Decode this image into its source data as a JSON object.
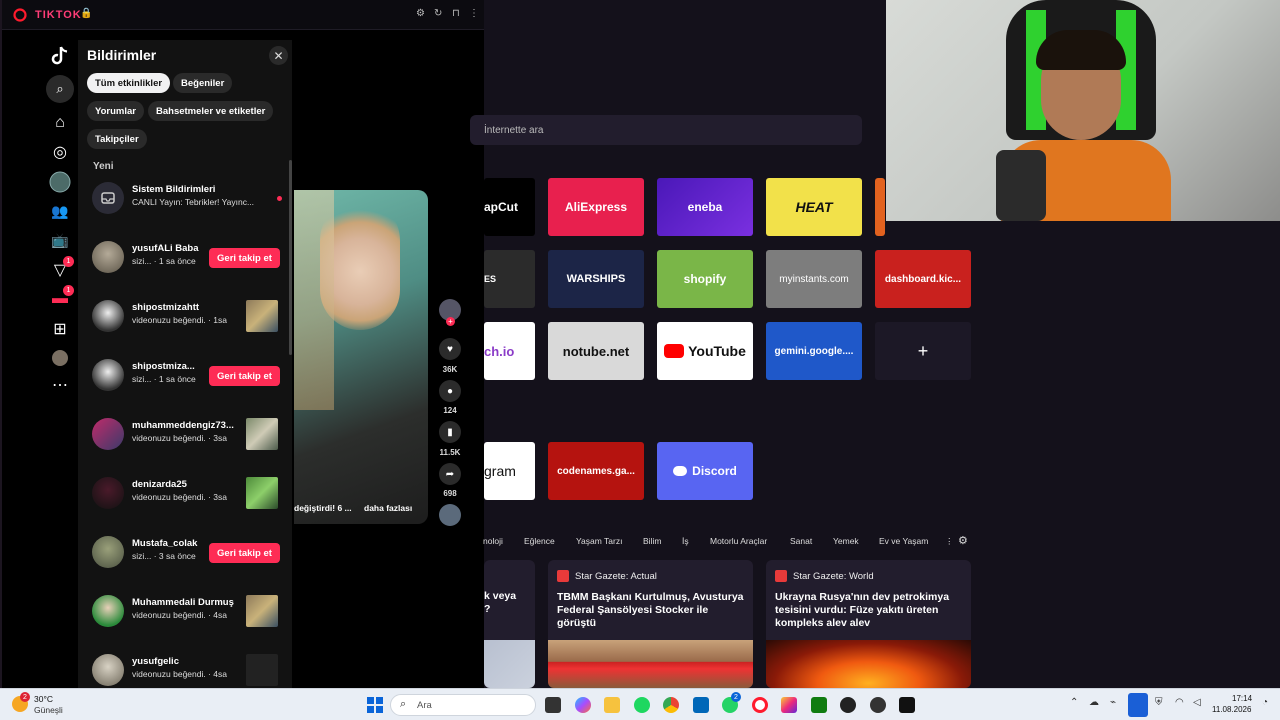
{
  "tiktok": {
    "title": "TIKTOK",
    "notifications": {
      "title": "Bildirimler",
      "filters": [
        "Tüm etkinlikler",
        "Beğeniler",
        "Yorumlar",
        "Bahsetmeler ve etiketler",
        "Takipçiler"
      ],
      "section": "Yeni",
      "items": [
        {
          "name": "Sistem Bildirimleri",
          "sub": "CANLI Yayın: Tebrikler! Yayınc...",
          "kind": "system"
        },
        {
          "name": "yusufALi Baba",
          "sub": "sizi... · 1 sa önce",
          "kind": "follow"
        },
        {
          "name": "shipostmizahtt",
          "sub": "videonuzu beğendi. · 1sa",
          "kind": "like"
        },
        {
          "name": "shipostmiza...",
          "sub": "sizi... · 1 sa önce",
          "kind": "follow"
        },
        {
          "name": "muhammeddengiz73...",
          "sub": "videonuzu beğendi. · 3sa",
          "kind": "like"
        },
        {
          "name": "denizarda25",
          "sub": "videonuzu beğendi. · 3sa",
          "kind": "like"
        },
        {
          "name": "Mustafa_colak",
          "sub": "sizi... · 3 sa önce",
          "kind": "follow"
        },
        {
          "name": "Muhammedali Durmuş",
          "sub": "videonuzu beğendi. · 4sa",
          "kind": "like"
        },
        {
          "name": "yusufgelic",
          "sub": "videonuzu beğendi. · 4sa",
          "kind": "like"
        }
      ],
      "follow_back_label": "Geri takip et"
    },
    "rail_badges": {
      "inbox": "1",
      "messages": "1"
    },
    "video": {
      "caption": "değiştirdi! 6 ...",
      "more": "daha fazlası",
      "likes": "36K",
      "comments": "124",
      "saves": "11.5K",
      "shares": "698"
    }
  },
  "browser": {
    "search_placeholder": "İnternette ara",
    "tiles": [
      {
        "label": "apCut",
        "color": "#000000"
      },
      {
        "label": "AliExpress",
        "color": "#e8204e"
      },
      {
        "label": "eneba",
        "color": "#5a20c8"
      },
      {
        "label": "HEAT",
        "color": "#f2e14a"
      },
      {
        "label": "",
        "color": "#e2621f"
      },
      {
        "label": "ES",
        "color": "#2b2b2b"
      },
      {
        "label": "WARSHIPS",
        "color": "#1c2547"
      },
      {
        "label": "shopify",
        "color": "#7ab648"
      },
      {
        "label": "myinstants.com",
        "color": "#7d7d7d"
      },
      {
        "label": "dashboard.kic...",
        "color": "#c9211e"
      },
      {
        "label": "ch.io",
        "color": "#ffffff"
      },
      {
        "label": "notube.net",
        "color": "#d9d9d9"
      },
      {
        "label": "YouTube",
        "color": "#ffffff"
      },
      {
        "label": "gemini.google....",
        "color": "#1f58c9"
      },
      {
        "label": "+",
        "color": "#1c1826"
      },
      {
        "label": "gram",
        "color": "#ffffff"
      },
      {
        "label": "codenames.ga...",
        "color": "#b5130f"
      },
      {
        "label": "Discord",
        "color": "#5865f2"
      }
    ],
    "categories": [
      "noloji",
      "Eğlence",
      "Yaşam Tarzı",
      "Bilim",
      "İş",
      "Motorlu Araçlar",
      "Sanat",
      "Yemek",
      "Ev ve Yaşam"
    ],
    "news": [
      {
        "source": "",
        "title": "k veya\n?"
      },
      {
        "source": "Star Gazete: Actual",
        "title": "TBMM Başkanı Kurtulmuş, Avusturya Federal Şansölyesi Stocker ile görüştü"
      },
      {
        "source": "Star Gazete: World",
        "title": "Ukrayna Rusya'nın dev petrokimya tesisini vurdu: Füze yakıtı üreten kompleks alev alev"
      }
    ]
  },
  "taskbar": {
    "weather_temp": "30°C",
    "weather_desc": "Güneşli",
    "weather_badge": "2",
    "search_placeholder": "Ara",
    "time": "17:14",
    "date": "11.08.2026",
    "whatsapp_badge": "2"
  },
  "colors": {
    "tiktok_red": "#fe2c55",
    "opera_red": "#ff1b2d"
  }
}
